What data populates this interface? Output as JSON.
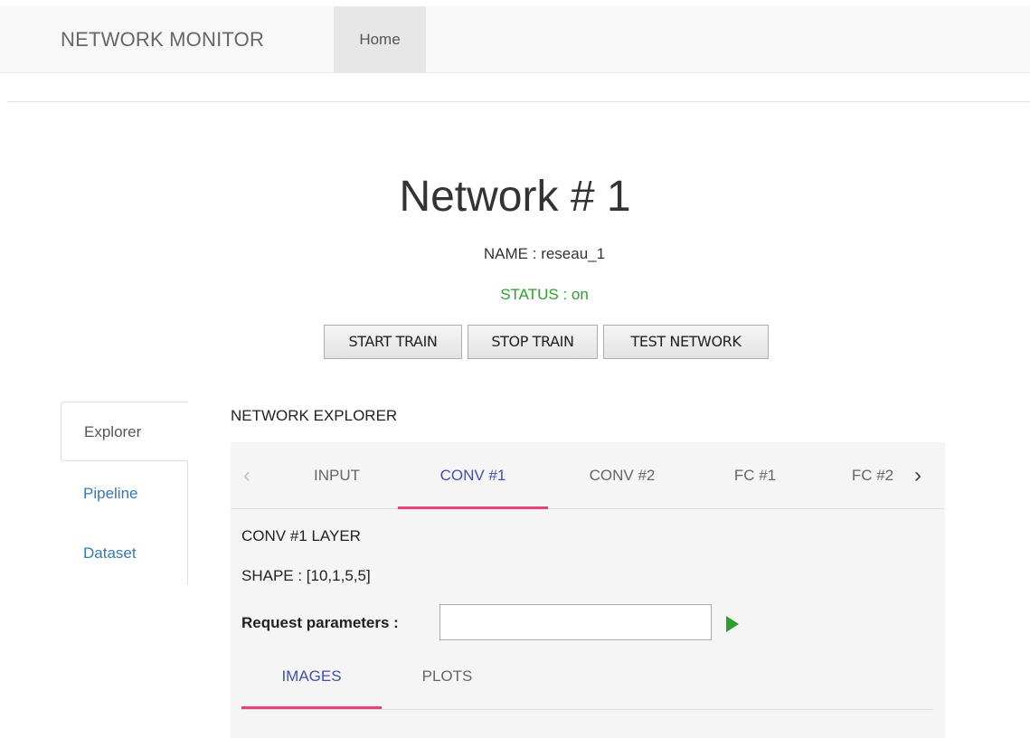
{
  "navbar": {
    "brand": "NETWORK MONITOR",
    "home": "Home"
  },
  "network": {
    "title": "Network # 1",
    "name": "NAME : reseau_1",
    "status": "STATUS : on",
    "status_color": "#2aa22a"
  },
  "buttons": {
    "start": "START TRAIN",
    "stop": "STOP TRAIN",
    "test": "TEST NETWORK"
  },
  "sidebar": {
    "items": [
      {
        "label": "Explorer",
        "active": true
      },
      {
        "label": "Pipeline",
        "active": false
      },
      {
        "label": "Dataset",
        "active": false
      }
    ]
  },
  "explorer": {
    "title": "NETWORK EXPLORER",
    "prev_icon": "chevron-left-icon",
    "next_icon": "chevron-right-icon",
    "layer_tabs": [
      {
        "label": "INPUT",
        "active": false
      },
      {
        "label": "CONV #1",
        "active": true
      },
      {
        "label": "CONV #2",
        "active": false
      },
      {
        "label": "FC #1",
        "active": false
      },
      {
        "label": "FC #2",
        "active": false
      }
    ],
    "layer_title": "CONV #1 LAYER",
    "shape": "SHAPE : [10,1,5,5]",
    "request_label": "Request parameters :",
    "request_value": "",
    "run_icon": "play-icon",
    "sub_tabs": [
      {
        "label": "IMAGES",
        "active": true
      },
      {
        "label": "PLOTS",
        "active": false
      }
    ]
  },
  "colors": {
    "accent": "#3f51b5",
    "ink": "#ec407a",
    "link": "#337ab7",
    "play": "#2e9e2e"
  }
}
